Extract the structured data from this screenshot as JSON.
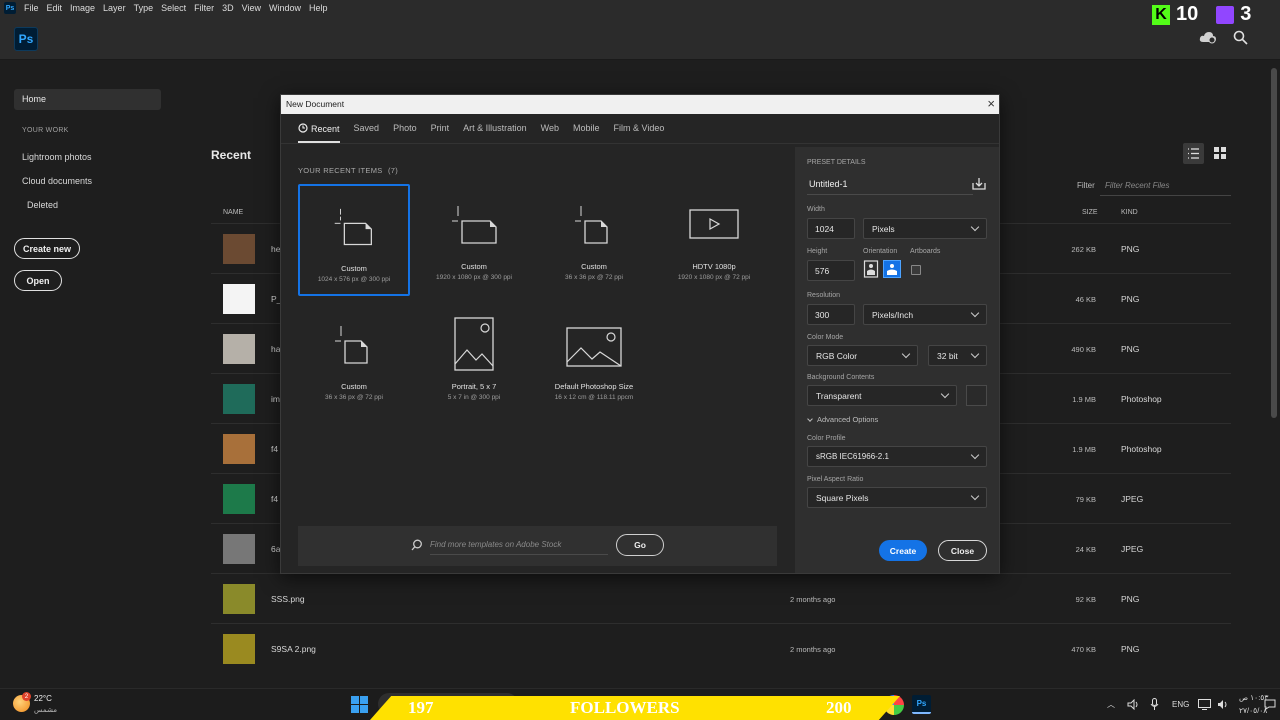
{
  "menubar": {
    "items": [
      "File",
      "Edit",
      "Image",
      "Layer",
      "Type",
      "Select",
      "Filter",
      "3D",
      "View",
      "Window",
      "Help"
    ]
  },
  "header": {
    "logo": "Ps",
    "icons": [
      "cloud-sync-icon",
      "search-icon"
    ]
  },
  "overlay": {
    "kick_count": "10",
    "kick_letter": "K",
    "twitch_count": "3"
  },
  "sidebar": {
    "home": "Home",
    "your_work": "YOUR WORK",
    "items": [
      "Lightroom photos",
      "Cloud documents",
      "Deleted"
    ],
    "create_new": "Create new",
    "open": "Open"
  },
  "background": {
    "title": "Recent",
    "filter_label": "Filter",
    "filter_placeholder": "Filter Recent Files",
    "columns": {
      "name": "NAME",
      "size": "SIZE",
      "kind": "KIND"
    },
    "rows": [
      {
        "name": "he",
        "date": "",
        "size": "262 KB",
        "kind": "PNG",
        "thumb": "#6b4a32"
      },
      {
        "name": "P_",
        "date": "",
        "size": "46 KB",
        "kind": "PNG",
        "thumb": "#f4f4f4"
      },
      {
        "name": "ha",
        "date": "",
        "size": "490 KB",
        "kind": "PNG",
        "thumb": "#b5b0a8"
      },
      {
        "name": "im",
        "date": "",
        "size": "1.9 MB",
        "kind": "Photoshop",
        "thumb": "#1f6b5a"
      },
      {
        "name": "f4",
        "date": "",
        "size": "1.9 MB",
        "kind": "Photoshop",
        "thumb": "#a8703a"
      },
      {
        "name": "f4",
        "date": "",
        "size": "79 KB",
        "kind": "JPEG",
        "thumb": "#1d7a4a"
      },
      {
        "name": "6a",
        "date": "",
        "size": "24 KB",
        "kind": "JPEG",
        "thumb": "#777777"
      },
      {
        "name": "SSS.png",
        "date": "2 months ago",
        "size": "92 KB",
        "kind": "PNG",
        "thumb": "#8a8a2a"
      },
      {
        "name": "S9SA 2.png",
        "date": "2 months ago",
        "size": "470 KB",
        "kind": "PNG",
        "thumb": "#9a8a20"
      }
    ]
  },
  "dialog": {
    "title": "New Document",
    "close": "×",
    "tabs": [
      "Recent",
      "Saved",
      "Photo",
      "Print",
      "Art & Illustration",
      "Web",
      "Mobile",
      "Film & Video"
    ],
    "recent_label": "YOUR RECENT ITEMS",
    "recent_count": "(7)",
    "items": [
      {
        "name": "Custom",
        "desc": "1024 x 576 px @ 300 ppi",
        "icon": "custom-document-icon"
      },
      {
        "name": "Custom",
        "desc": "1920 x 1080 px @ 300 ppi",
        "icon": "custom-document-icon"
      },
      {
        "name": "Custom",
        "desc": "36 x 36 px @ 72 ppi",
        "icon": "custom-document-icon"
      },
      {
        "name": "HDTV 1080p",
        "desc": "1920 x 1080 px @ 72 ppi",
        "icon": "video-icon"
      },
      {
        "name": "Custom",
        "desc": "36 x 36 px @ 72 ppi",
        "icon": "custom-document-icon"
      },
      {
        "name": "Portrait, 5 x 7",
        "desc": "5 x 7 in @ 300 ppi",
        "icon": "portrait-photo-icon"
      },
      {
        "name": "Default Photoshop Size",
        "desc": "16 x 12 cm @ 118.11 ppcm",
        "icon": "landscape-photo-icon"
      }
    ],
    "search_placeholder": "Find more templates on Adobe Stock",
    "go": "Go",
    "preset": {
      "heading": "PRESET DETAILS",
      "name": "Untitled-1",
      "width_label": "Width",
      "width": "1024",
      "width_unit": "Pixels",
      "height_label": "Height",
      "height": "576",
      "orientation_label": "Orientation",
      "artboards_label": "Artboards",
      "resolution_label": "Resolution",
      "resolution": "300",
      "resolution_unit": "Pixels/Inch",
      "color_mode_label": "Color Mode",
      "color_mode": "RGB Color",
      "bit_depth": "32 bit",
      "background_label": "Background Contents",
      "background": "Transparent",
      "advanced": "Advanced Options",
      "profile_label": "Color Profile",
      "profile": "sRGB IEC61966-2.1",
      "pixel_aspect_label": "Pixel Aspect Ratio",
      "pixel_aspect": "Square Pixels"
    },
    "create": "Create",
    "close_button": "Close"
  },
  "taskbar": {
    "weather_temp": "22°C",
    "weather_desc": "مشمس",
    "weather_badge": "2",
    "banner_left": "197",
    "banner_mid": "FOLLOWERS",
    "banner_right": "200",
    "lang": "ENG",
    "time": "١٠:٥٣ ص",
    "date": "٢٧/٠٥/٠٨"
  },
  "colors": {
    "accent": "#1473e6",
    "ps_blue": "#31a8ff",
    "banner": "#ffe100",
    "kick_green": "#53fc18",
    "twitch_purple": "#9146ff"
  }
}
